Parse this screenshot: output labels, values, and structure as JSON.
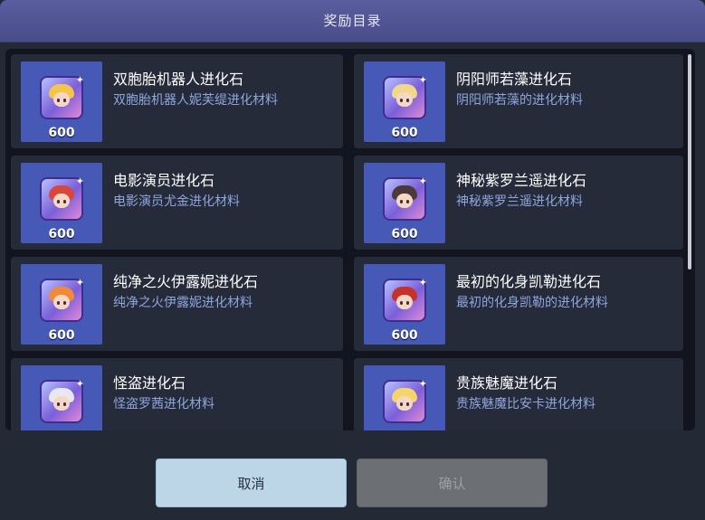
{
  "dialog": {
    "title": "奖励目录"
  },
  "items": [
    {
      "name": "双胞胎机器人进化石",
      "desc": "双胞胎机器人妮芙缇进化材料",
      "count": "600",
      "hair": "#f3c64a"
    },
    {
      "name": "阴阳师若藻进化石",
      "desc": "阴阳师若藻的进化材料",
      "count": "600",
      "hair": "#f0d78a"
    },
    {
      "name": "电影演员进化石",
      "desc": "电影演员尤金进化材料",
      "count": "600",
      "hair": "#d8483a"
    },
    {
      "name": "神秘紫罗兰遥进化石",
      "desc": "神秘紫罗兰遥进化材料",
      "count": "600",
      "hair": "#4a3a3a"
    },
    {
      "name": "纯净之火伊露妮进化石",
      "desc": "纯净之火伊露妮进化材料",
      "count": "600",
      "hair": "#f08a3a"
    },
    {
      "name": "最初的化身凯勒进化石",
      "desc": "最初的化身凯勒的进化材料",
      "count": "600",
      "hair": "#c8302c"
    },
    {
      "name": "怪盗进化石",
      "desc": "怪盗罗茜进化材料",
      "count": "",
      "hair": "#e8e8f0"
    },
    {
      "name": "贵族魅魔进化石",
      "desc": "贵族魅魔比安卡进化材料",
      "count": "",
      "hair": "#f5d46a"
    }
  ],
  "buttons": {
    "cancel": "取消",
    "confirm": "确认"
  }
}
